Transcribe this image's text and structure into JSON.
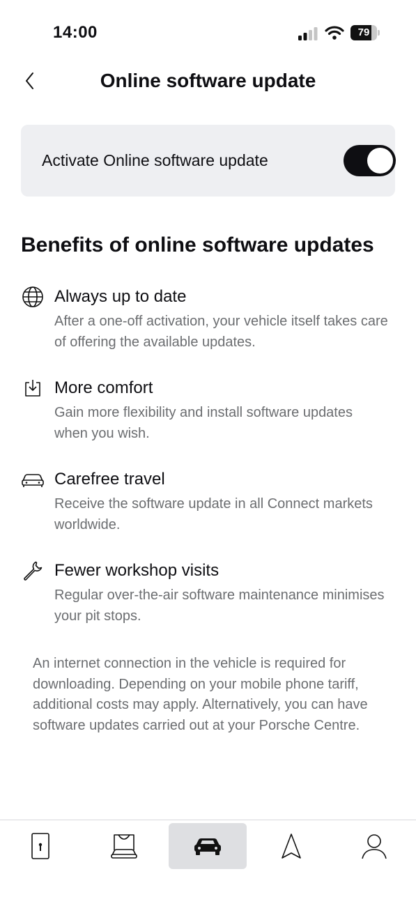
{
  "status_bar": {
    "time": "14:00",
    "battery_level": "79",
    "battery_fraction": 0.79
  },
  "header": {
    "title": "Online software update",
    "back_icon": "chevron-left-icon"
  },
  "toggle_card": {
    "label": "Activate Online software update",
    "toggle_on": true
  },
  "benefits": {
    "heading": "Benefits of online software updates",
    "items": [
      {
        "icon": "globe-icon",
        "title": "Always up to date",
        "description": "After a one-off activation, your vehicle itself takes care of offering the available updates."
      },
      {
        "icon": "download-icon",
        "title": "More comfort",
        "description": "Gain more flexibility and install software updates when you wish."
      },
      {
        "icon": "car-icon",
        "title": "Carefree travel",
        "description": "Receive the software update in all Connect markets worldwide."
      },
      {
        "icon": "wrench-icon",
        "title": "Fewer workshop visits",
        "description": "Regular over-the-air software maintenance minimises your pit stops."
      }
    ]
  },
  "footnote": "An internet connection in the vehicle is required for downloading. Depending on your mobile phone tariff, additional costs may apply. Alternatively, you can have software updates carried out at your Porsche Centre.",
  "tab_bar": {
    "tabs": [
      {
        "icon": "phone-key-icon",
        "active": false
      },
      {
        "icon": "car-shop-icon",
        "active": false
      },
      {
        "icon": "car-icon",
        "active": true
      },
      {
        "icon": "navigation-icon",
        "active": false
      },
      {
        "icon": "profile-icon",
        "active": false
      }
    ]
  },
  "colors": {
    "text_primary": "#0e0e12",
    "text_secondary": "#6b6d70",
    "card_background": "#eeeff2",
    "active_tab_background": "#dedfe2"
  }
}
